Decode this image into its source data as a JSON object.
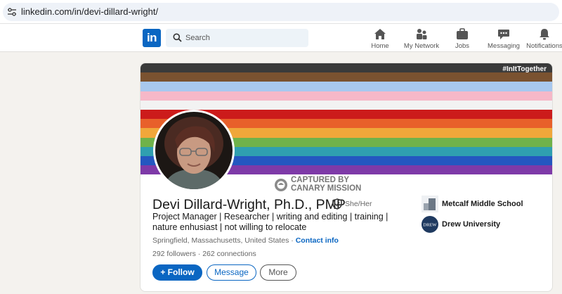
{
  "browser": {
    "url": "linkedin.com/in/devi-dillard-wright/"
  },
  "nav": {
    "logo": "in",
    "search_placeholder": "Search",
    "items": [
      {
        "label": "Home",
        "icon": "home-icon"
      },
      {
        "label": "My Network",
        "icon": "network-icon"
      },
      {
        "label": "Jobs",
        "icon": "briefcase-icon"
      },
      {
        "label": "Messaging",
        "icon": "chat-icon"
      },
      {
        "label": "Notifications",
        "icon": "bell-icon"
      }
    ]
  },
  "banner": {
    "hashtag": "#InItTogether",
    "stripes": [
      "#3a3a3a",
      "#7a5230",
      "#a8c8ee",
      "#f6b8c8",
      "#f2f2f2",
      "#cc1b1b",
      "#e8602a",
      "#f0a73a",
      "#6fb24a",
      "#2f9fb0",
      "#2457c0",
      "#7e3aa8"
    ]
  },
  "watermark": {
    "line1": "CAPTURED BY",
    "line2": "CANARY MISSION"
  },
  "profile": {
    "name": "Devi Dillard-Wright, Ph.D., PMP",
    "pronouns": "She/Her",
    "headline": "Project Manager | Researcher | writing and editing | training | nature enhusiast | not willing to relocate",
    "location": "Springfield, Massachusetts, United States",
    "separator": " · ",
    "contact_info": "Contact info",
    "followers": "292 followers",
    "stats_separator": " · ",
    "connections": "262 connections"
  },
  "actions": {
    "follow": "+ Follow",
    "message": "Message",
    "more": "More"
  },
  "organizations": [
    {
      "name": "Metcalf Middle School"
    },
    {
      "name": "Drew University",
      "logo_text": "DREW"
    }
  ],
  "colors": {
    "accent": "#0a66c2",
    "page_bg": "#f4f2ee"
  }
}
